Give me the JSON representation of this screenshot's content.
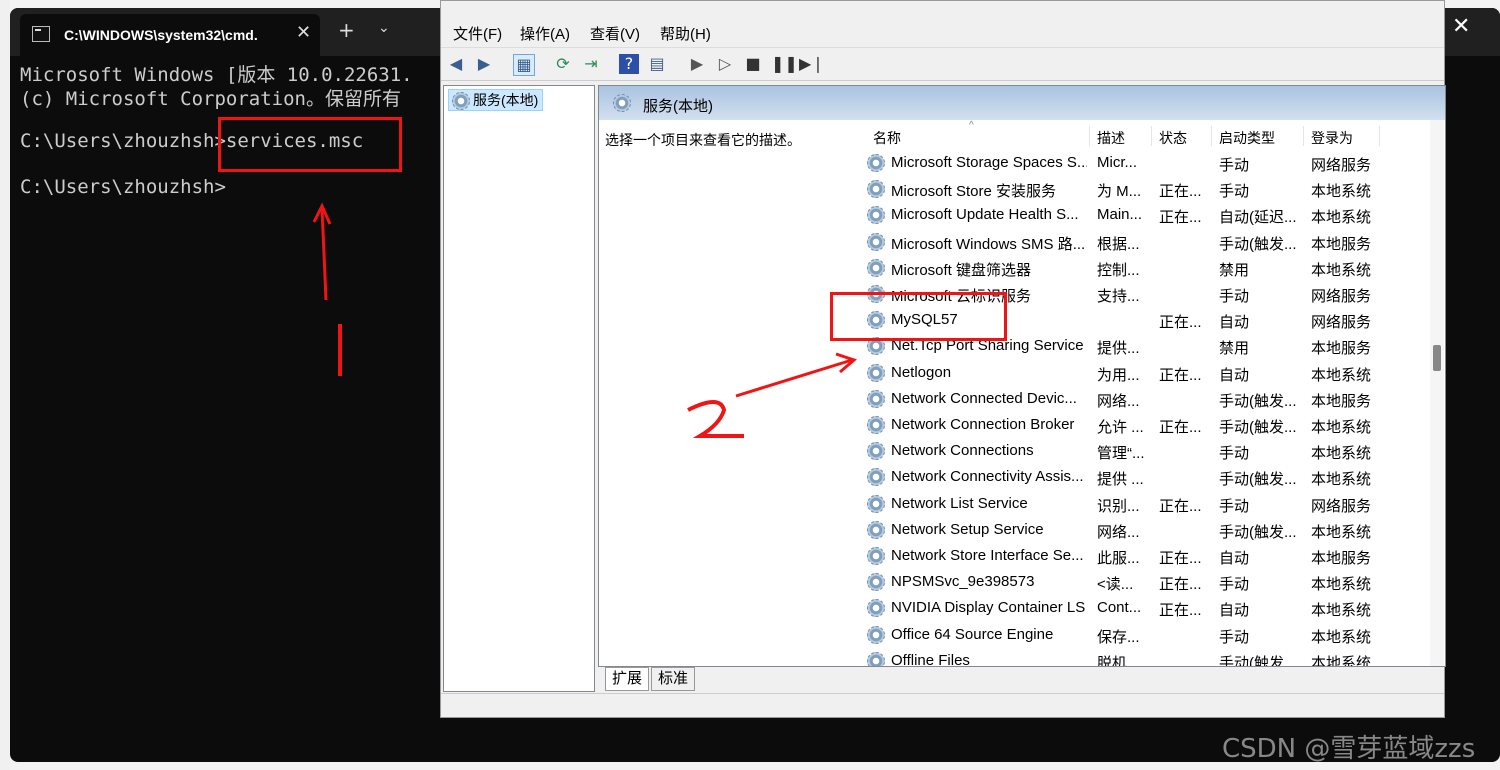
{
  "terminal": {
    "tab_title": "C:\\WINDOWS\\system32\\cmd.",
    "new_tab": "+",
    "dropdown": "⌄",
    "close": "✕",
    "lines": [
      "Microsoft Windows [版本 10.0.22631.",
      "(c) Microsoft Corporation。保留所有",
      "C:\\Users\\zhouzhsh>services.msc",
      "C:\\Users\\zhouzhsh>"
    ]
  },
  "services": {
    "menu": [
      "文件(F)",
      "操作(A)",
      "查看(V)",
      "帮助(H)"
    ],
    "tree_item": "服务(本地)",
    "pane_title": "服务(本地)",
    "description": "选择一个项目来查看它的描述。",
    "columns": [
      "名称",
      "描述",
      "状态",
      "启动类型",
      "登录为"
    ],
    "rows": [
      {
        "name": "Microsoft Storage Spaces S...",
        "desc": "Micr...",
        "status": "",
        "startup": "手动",
        "logon": "网络服务"
      },
      {
        "name": "Microsoft Store 安装服务",
        "desc": "为 M...",
        "status": "正在...",
        "startup": "手动",
        "logon": "本地系统"
      },
      {
        "name": "Microsoft Update Health S...",
        "desc": "Main...",
        "status": "正在...",
        "startup": "自动(延迟...",
        "logon": "本地系统"
      },
      {
        "name": "Microsoft Windows SMS 路...",
        "desc": "根据...",
        "status": "",
        "startup": "手动(触发...",
        "logon": "本地服务"
      },
      {
        "name": "Microsoft 键盘筛选器",
        "desc": "控制...",
        "status": "",
        "startup": "禁用",
        "logon": "本地系统"
      },
      {
        "name": "Microsoft 云标识服务",
        "desc": "支持...",
        "status": "",
        "startup": "手动",
        "logon": "网络服务"
      },
      {
        "name": "MySQL57",
        "desc": "",
        "status": "正在...",
        "startup": "自动",
        "logon": "网络服务"
      },
      {
        "name": "Net.Tcp Port Sharing Service",
        "desc": "提供...",
        "status": "",
        "startup": "禁用",
        "logon": "本地服务"
      },
      {
        "name": "Netlogon",
        "desc": "为用...",
        "status": "正在...",
        "startup": "自动",
        "logon": "本地系统"
      },
      {
        "name": "Network Connected Devic...",
        "desc": "网络...",
        "status": "",
        "startup": "手动(触发...",
        "logon": "本地服务"
      },
      {
        "name": "Network Connection Broker",
        "desc": "允许 ...",
        "status": "正在...",
        "startup": "手动(触发...",
        "logon": "本地系统"
      },
      {
        "name": "Network Connections",
        "desc": "管理“...",
        "status": "",
        "startup": "手动",
        "logon": "本地系统"
      },
      {
        "name": "Network Connectivity Assis...",
        "desc": "提供 ...",
        "status": "",
        "startup": "手动(触发...",
        "logon": "本地系统"
      },
      {
        "name": "Network List Service",
        "desc": "识别...",
        "status": "正在...",
        "startup": "手动",
        "logon": "网络服务"
      },
      {
        "name": "Network Setup Service",
        "desc": "网络...",
        "status": "",
        "startup": "手动(触发...",
        "logon": "本地系统"
      },
      {
        "name": "Network Store Interface Se...",
        "desc": "此服...",
        "status": "正在...",
        "startup": "自动",
        "logon": "本地服务"
      },
      {
        "name": "NPSMSvc_9e398573",
        "desc": "<读...",
        "status": "正在...",
        "startup": "手动",
        "logon": "本地系统"
      },
      {
        "name": "NVIDIA Display Container LS",
        "desc": "Cont...",
        "status": "正在...",
        "startup": "自动",
        "logon": "本地系统"
      },
      {
        "name": "Office 64 Source Engine",
        "desc": "保存...",
        "status": "",
        "startup": "手动",
        "logon": "本地系统"
      },
      {
        "name": "Offline Files",
        "desc": "脱机...",
        "status": "",
        "startup": "手动(触发...",
        "logon": "本地系统"
      }
    ],
    "tabs": [
      "扩展",
      "标准"
    ]
  },
  "annotations": {
    "mark1": "1",
    "mark2": "2"
  },
  "watermark": "CSDN @雪芽蓝域zzs",
  "colors": {
    "annotation": "#f01414",
    "terminal_bg": "#0c0c0c",
    "selection": "#cce8ff"
  }
}
